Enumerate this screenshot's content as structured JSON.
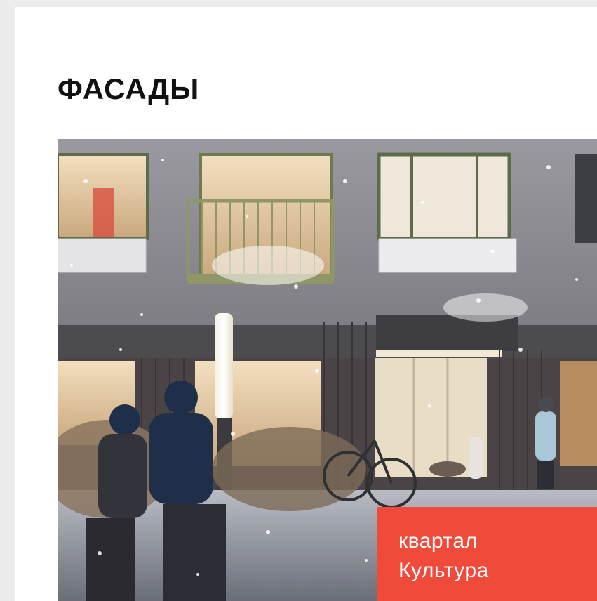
{
  "section": {
    "title": "ФАСАДЫ"
  },
  "badge": {
    "line1": "квартал",
    "line2": "Культура",
    "color": "#f04b3a"
  },
  "image": {
    "icon": "building-facade-render"
  }
}
